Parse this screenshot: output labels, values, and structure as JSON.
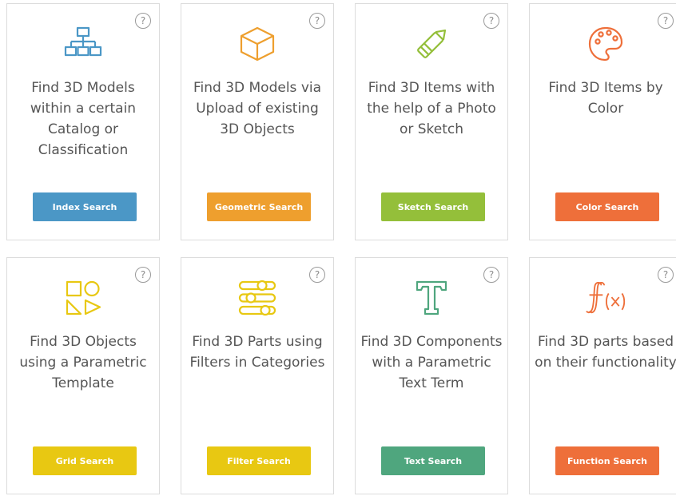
{
  "help_symbol": "?",
  "cards": [
    {
      "title": "Find 3D Models within a certain Catalog or Classification",
      "button": "Index Search",
      "icon": "hierarchy-icon",
      "color": "#4b97c6"
    },
    {
      "title": "Find 3D Models via Upload of existing 3D Objects",
      "button": "Geometric Search",
      "icon": "cube-icon",
      "color": "#ee9f2e"
    },
    {
      "title": "Find 3D Items with the help of a Photo or Sketch",
      "button": "Sketch Search",
      "icon": "pencil-icon",
      "color": "#94bf3a"
    },
    {
      "title": "Find 3D Items by Color",
      "button": "Color Search",
      "icon": "palette-icon",
      "color": "#ee6f3a"
    },
    {
      "title": "Find 3D Objects using a Parametric Template",
      "button": "Grid Search",
      "icon": "shapes-icon",
      "color": "#e8c812"
    },
    {
      "title": "Find 3D Parts using Filters in Categories",
      "button": "Filter Search",
      "icon": "sliders-icon",
      "color": "#e8c812"
    },
    {
      "title": "Find 3D Components with a Parametric Text Term",
      "button": "Text Search",
      "icon": "text-icon",
      "color": "#4fa67e"
    },
    {
      "title": "Find 3D parts based on their functionality",
      "button": "Function Search",
      "icon": "function-icon",
      "color": "#ee6f3a"
    }
  ]
}
